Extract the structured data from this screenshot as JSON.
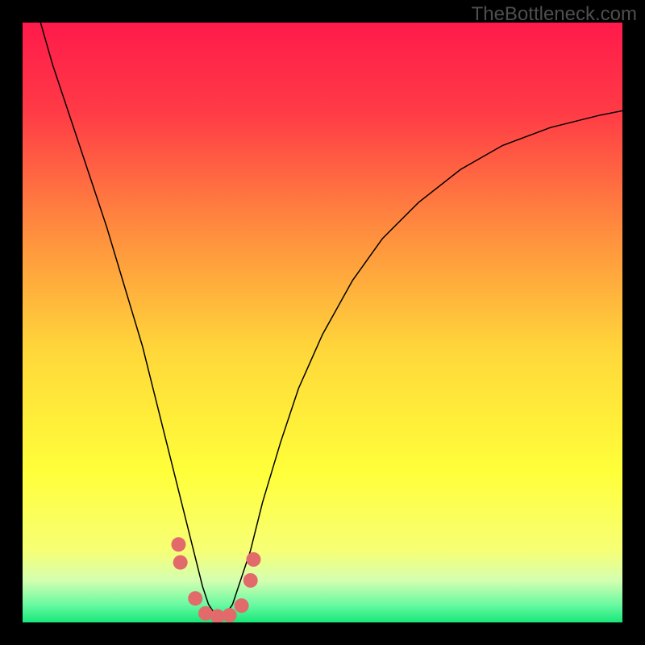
{
  "watermark": "TheBottleneck.com",
  "chart_data": {
    "type": "line",
    "title": "",
    "xlabel": "",
    "ylabel": "",
    "xlim": [
      0,
      100
    ],
    "ylim": [
      0,
      100
    ],
    "background": {
      "type": "vertical-gradient",
      "stops": [
        {
          "pos": 0.0,
          "color": "#ff1a4b"
        },
        {
          "pos": 0.15,
          "color": "#ff3b46"
        },
        {
          "pos": 0.35,
          "color": "#ff8e3e"
        },
        {
          "pos": 0.55,
          "color": "#ffd83a"
        },
        {
          "pos": 0.75,
          "color": "#ffff3a"
        },
        {
          "pos": 0.88,
          "color": "#f7ff75"
        },
        {
          "pos": 0.93,
          "color": "#d4ffb0"
        },
        {
          "pos": 0.97,
          "color": "#6bf9a2"
        },
        {
          "pos": 1.0,
          "color": "#17e87a"
        }
      ]
    },
    "series": [
      {
        "name": "bottleneck-curve",
        "stroke": "#000000",
        "stroke_width": 1.5,
        "x": [
          3,
          5,
          8,
          11,
          14,
          17,
          20,
          22,
          24,
          26,
          27.5,
          29,
          30,
          31,
          32,
          33,
          34,
          35,
          36,
          38,
          40,
          43,
          46,
          50,
          55,
          60,
          66,
          73,
          80,
          88,
          96,
          100
        ],
        "y": [
          100,
          93,
          84,
          75,
          66,
          56,
          46,
          38,
          30,
          22,
          16,
          10,
          6,
          3,
          1.5,
          1,
          1.5,
          3,
          6,
          12,
          20,
          30,
          39,
          48,
          57,
          64,
          70,
          75.5,
          79.5,
          82.5,
          84.5,
          85.3
        ]
      }
    ],
    "markers": {
      "color": "#e26a6a",
      "radius_px": 9,
      "points": [
        {
          "x": 26.0,
          "y": 13.0
        },
        {
          "x": 26.3,
          "y": 10.0
        },
        {
          "x": 28.8,
          "y": 4.0
        },
        {
          "x": 30.5,
          "y": 1.5
        },
        {
          "x": 32.5,
          "y": 1.0
        },
        {
          "x": 34.5,
          "y": 1.2
        },
        {
          "x": 36.5,
          "y": 2.8
        },
        {
          "x": 38.0,
          "y": 7.0
        },
        {
          "x": 38.5,
          "y": 10.5
        }
      ]
    }
  }
}
